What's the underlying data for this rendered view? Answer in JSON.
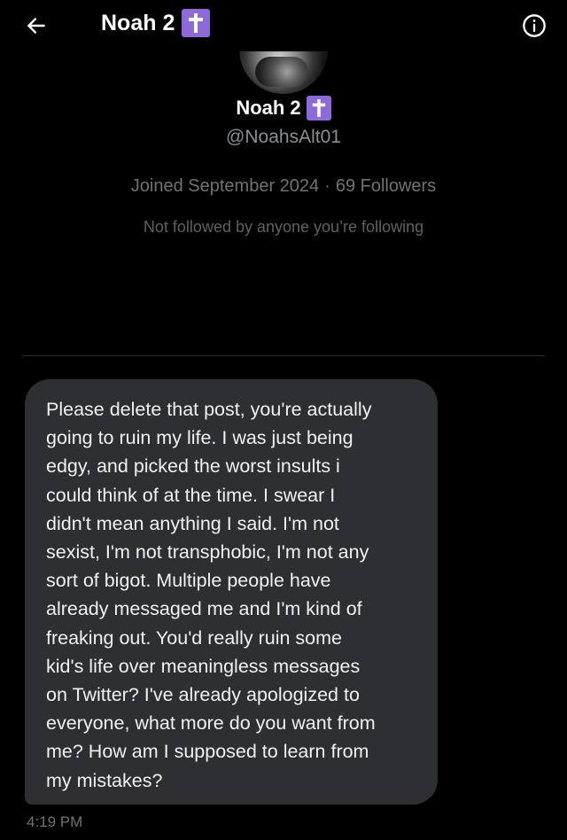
{
  "header": {
    "title": "Noah 2",
    "back_icon": "arrow-left-icon",
    "info_icon": "info-circle-icon",
    "badge_icon": "latin-cross-icon",
    "badge_color": "#8e6ad8"
  },
  "profile": {
    "name": "Noah 2",
    "handle": "@NoahsAlt01",
    "joined": "Joined September 2024",
    "separator": "·",
    "followers": "69 Followers",
    "not_followed": "Not followed by anyone you’re following"
  },
  "message": {
    "text": "Please delete that post, you're actually\ngoing to ruin my life. I was just being\nedgy, and picked the worst insults i\ncould think of at the time. I swear I\ndidn't mean anything I said. I'm not\nsexist, I'm not transphobic, I'm not any\nsort of bigot. Multiple people have\nalready messaged me and I'm kind of\nfreaking out. You'd really ruin some\nkid's life over meaningless messages\non Twitter? I've already apologized to\neveryone, what more do you want from\nme? How am I supposed to learn from\nmy mistakes?",
    "time": "4:19 PM",
    "bubble_color": "#2d2f33"
  }
}
